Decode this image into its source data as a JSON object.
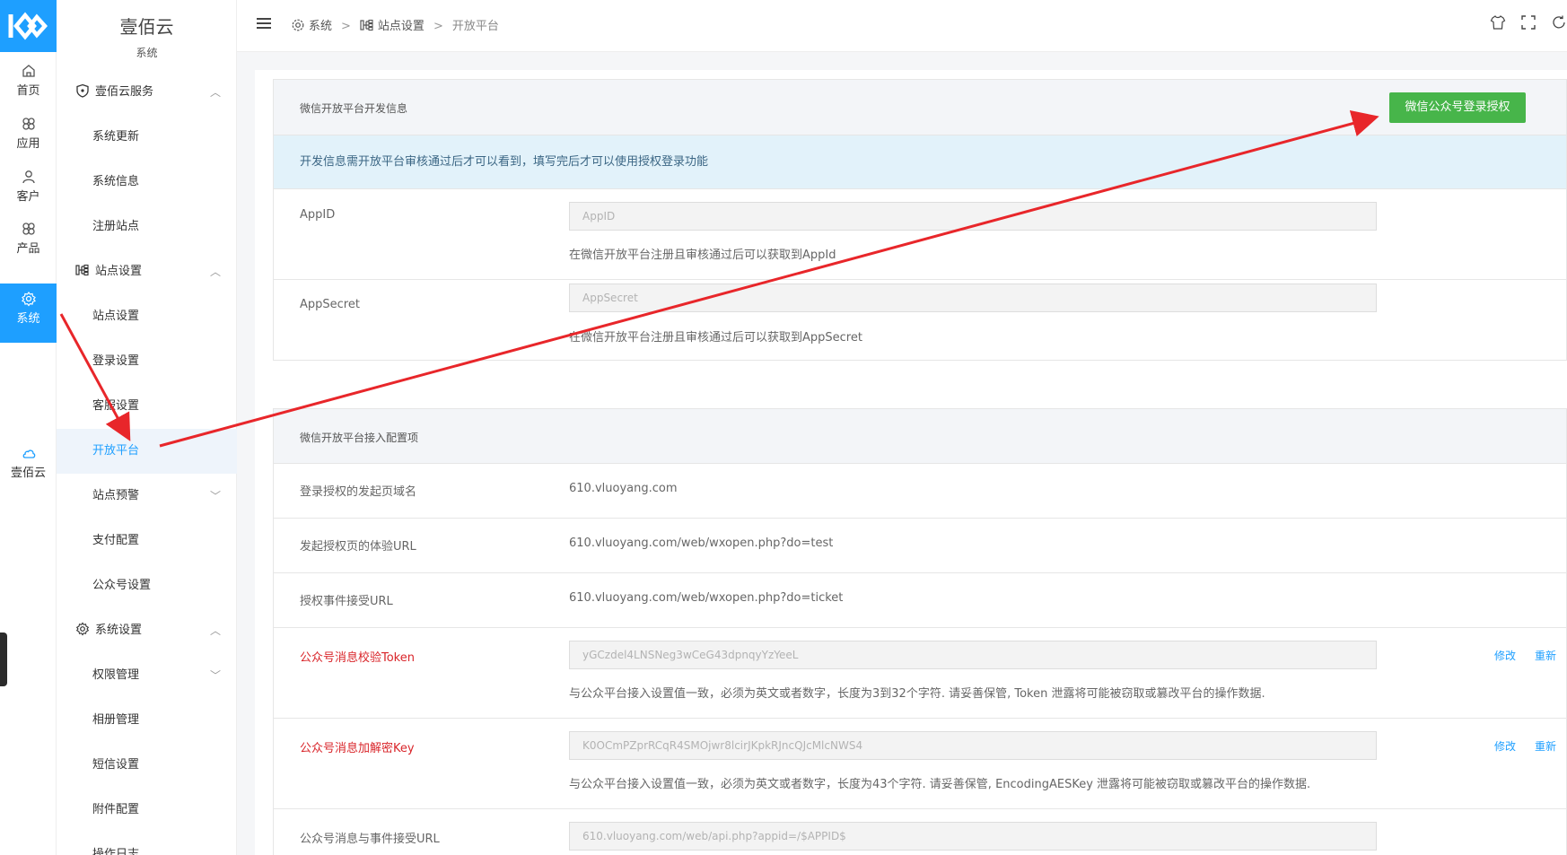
{
  "rail": {
    "items": [
      {
        "label": "首页",
        "icon": "home-icon"
      },
      {
        "label": "应用",
        "icon": "apps-icon"
      },
      {
        "label": "客户",
        "icon": "user-icon"
      },
      {
        "label": "产品",
        "icon": "product-icon"
      },
      {
        "label": "系统",
        "icon": "gear-icon",
        "active": true
      },
      {
        "label": "壹佰云",
        "icon": "cloud-icon"
      }
    ]
  },
  "sidebar": {
    "title": "壹佰云",
    "subtitle": "系统",
    "groups": {
      "service": "壹佰云服务",
      "site": "站点设置",
      "system": "系统设置"
    },
    "items": {
      "update": "系统更新",
      "info": "系统信息",
      "register": "注册站点",
      "site_settings": "站点设置",
      "login_settings": "登录设置",
      "service_settings": "客服设置",
      "open_platform": "开放平台",
      "site_alert": "站点预警",
      "payment": "支付配置",
      "mp_settings": "公众号设置",
      "permissions": "权限管理",
      "album": "相册管理",
      "sms": "短信设置",
      "attachments": "附件配置",
      "logs": "操作日志"
    }
  },
  "topbar": {
    "breadcrumb": [
      "系统",
      "站点设置",
      "开放平台"
    ],
    "separator": ">"
  },
  "dev_card": {
    "title": "微信开放平台开发信息",
    "auth_button": "微信公众号登录授权",
    "tip": "开发信息需开放平台审核通过后才可以看到，填写完后才可以使用授权登录功能",
    "appid": {
      "label": "AppID",
      "placeholder": "AppID",
      "help": "在微信开放平台注册且审核通过后可以获取到AppId"
    },
    "appsecret": {
      "label": "AppSecret",
      "placeholder": "AppSecret",
      "help": "在微信开放平台注册且审核通过后可以获取到AppSecret"
    }
  },
  "config_card": {
    "title": "微信开放平台接入配置项",
    "domain": {
      "label": "登录授权的发起页域名",
      "value": "610.vluoyang.com"
    },
    "test_url": {
      "label": "发起授权页的体验URL",
      "value": "610.vluoyang.com/web/wxopen.php?do=test"
    },
    "ticket_url": {
      "label": "授权事件接受URL",
      "value": "610.vluoyang.com/web/wxopen.php?do=ticket"
    },
    "token": {
      "label": "公众号消息校验Token",
      "value": "yGCzdel4LNSNeg3wCeG43dpnqyYzYeeL",
      "help": "与公众平台接入设置值一致，必须为英文或者数字，长度为3到32个字符. 请妥善保管, Token 泄露将可能被窃取或篡改平台的操作数据.",
      "edit": "修改",
      "regen": "重新"
    },
    "aeskey": {
      "label": "公众号消息加解密Key",
      "value": "K0OCmPZprRCqR4SMOjwr8lcirJKpkRJncQJcMlcNWS4",
      "help": "与公众平台接入设置值一致，必须为英文或者数字，长度为43个字符. 请妥善保管, EncodingAESKey 泄露将可能被窃取或篡改平台的操作数据.",
      "edit": "修改",
      "regen": "重新"
    },
    "msg_url": {
      "label": "公众号消息与事件接受URL",
      "value": "610.vluoyang.com/web/api.php?appid=/$APPID$"
    }
  },
  "colors": {
    "accent": "#1e9fff",
    "button_green": "#47b54a",
    "warning_red": "#d9252a",
    "tip_bg": "#e2f2fa",
    "arrow": "#e8262a"
  }
}
